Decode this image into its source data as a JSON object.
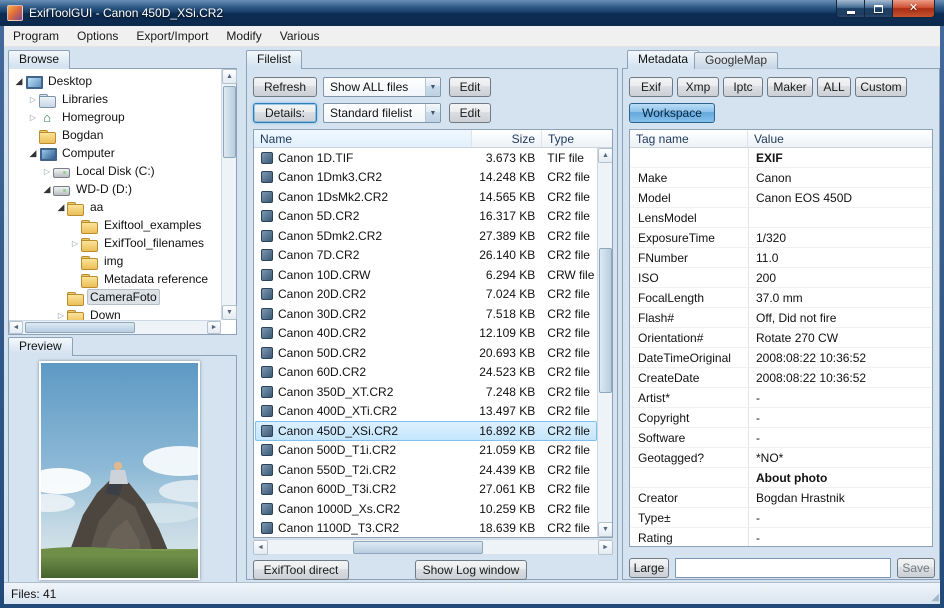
{
  "window": {
    "title": "ExifToolGUI - Canon 450D_XSi.CR2",
    "status": "Files: 41"
  },
  "menubar": {
    "items": [
      "Program",
      "Options",
      "Export/Import",
      "Modify",
      "Various"
    ]
  },
  "browse": {
    "tab_label": "Browse",
    "tree": [
      {
        "label": "Desktop",
        "level": 0,
        "icon": "desktop",
        "expander": "expanded",
        "selected": false
      },
      {
        "label": "Libraries",
        "level": 1,
        "icon": "libraries",
        "expander": "collapsed",
        "selected": false
      },
      {
        "label": "Homegroup",
        "level": 1,
        "icon": "homegroup",
        "expander": "collapsed",
        "selected": false
      },
      {
        "label": "Bogdan",
        "level": 1,
        "icon": "user",
        "expander": "none",
        "selected": false
      },
      {
        "label": "Computer",
        "level": 1,
        "icon": "computer",
        "expander": "expanded",
        "selected": false
      },
      {
        "label": "Local Disk (C:)",
        "level": 2,
        "icon": "disk",
        "expander": "collapsed",
        "selected": false
      },
      {
        "label": "WD-D (D:)",
        "level": 2,
        "icon": "disk",
        "expander": "expanded",
        "selected": false
      },
      {
        "label": "aa",
        "level": 3,
        "icon": "folder",
        "expander": "expanded",
        "selected": false
      },
      {
        "label": "Exiftool_examples",
        "level": 4,
        "icon": "folder",
        "expander": "none",
        "selected": false
      },
      {
        "label": "ExifTool_filenames",
        "level": 4,
        "icon": "folder",
        "expander": "collapsed",
        "selected": false
      },
      {
        "label": "img",
        "level": 4,
        "icon": "folder",
        "expander": "none",
        "selected": false
      },
      {
        "label": "Metadata reference",
        "level": 4,
        "icon": "folder",
        "expander": "none",
        "selected": false
      },
      {
        "label": "CameraFoto",
        "level": 3,
        "icon": "folder",
        "expander": "none",
        "selected": true
      },
      {
        "label": "Down",
        "level": 3,
        "icon": "folder",
        "expander": "collapsed",
        "selected": false
      }
    ]
  },
  "preview": {
    "tab_label": "Preview"
  },
  "filelist": {
    "tab_label": "Filelist",
    "refresh_label": "Refresh",
    "filter_value": "Show ALL files",
    "filter_edit_label": "Edit",
    "details_label": "Details:",
    "details_value": "Standard filelist",
    "details_edit_label": "Edit",
    "columns": [
      "Name",
      "Size",
      "Type"
    ],
    "rows": [
      {
        "name": "Canon 1D.TIF",
        "size": "3.673 KB",
        "type": "TIF file",
        "selected": false
      },
      {
        "name": "Canon 1Dmk3.CR2",
        "size": "14.248 KB",
        "type": "CR2 file",
        "selected": false
      },
      {
        "name": "Canon 1DsMk2.CR2",
        "size": "14.565 KB",
        "type": "CR2 file",
        "selected": false
      },
      {
        "name": "Canon 5D.CR2",
        "size": "16.317 KB",
        "type": "CR2 file",
        "selected": false
      },
      {
        "name": "Canon 5Dmk2.CR2",
        "size": "27.389 KB",
        "type": "CR2 file",
        "selected": false
      },
      {
        "name": "Canon 7D.CR2",
        "size": "26.140 KB",
        "type": "CR2 file",
        "selected": false
      },
      {
        "name": "Canon 10D.CRW",
        "size": "6.294 KB",
        "type": "CRW file",
        "selected": false
      },
      {
        "name": "Canon 20D.CR2",
        "size": "7.024 KB",
        "type": "CR2 file",
        "selected": false
      },
      {
        "name": "Canon 30D.CR2",
        "size": "7.518 KB",
        "type": "CR2 file",
        "selected": false
      },
      {
        "name": "Canon 40D.CR2",
        "size": "12.109 KB",
        "type": "CR2 file",
        "selected": false
      },
      {
        "name": "Canon 50D.CR2",
        "size": "20.693 KB",
        "type": "CR2 file",
        "selected": false
      },
      {
        "name": "Canon 60D.CR2",
        "size": "24.523 KB",
        "type": "CR2 file",
        "selected": false
      },
      {
        "name": "Canon 350D_XT.CR2",
        "size": "7.248 KB",
        "type": "CR2 file",
        "selected": false
      },
      {
        "name": "Canon 400D_XTi.CR2",
        "size": "13.497 KB",
        "type": "CR2 file",
        "selected": false
      },
      {
        "name": "Canon 450D_XSi.CR2",
        "size": "16.892 KB",
        "type": "CR2 file",
        "selected": true
      },
      {
        "name": "Canon 500D_T1i.CR2",
        "size": "21.059 KB",
        "type": "CR2 file",
        "selected": false
      },
      {
        "name": "Canon 550D_T2i.CR2",
        "size": "24.439 KB",
        "type": "CR2 file",
        "selected": false
      },
      {
        "name": "Canon 600D_T3i.CR2",
        "size": "27.061 KB",
        "type": "CR2 file",
        "selected": false
      },
      {
        "name": "Canon 1000D_Xs.CR2",
        "size": "10.259 KB",
        "type": "CR2 file",
        "selected": false
      },
      {
        "name": "Canon 1100D_T3.CR2",
        "size": "18.639 KB",
        "type": "CR2 file",
        "selected": false
      }
    ],
    "exiftool_direct_label": "ExifTool direct",
    "show_log_label": "Show Log window"
  },
  "metadata": {
    "tabs": [
      {
        "label": "Metadata",
        "active": true
      },
      {
        "label": "GoogleMap",
        "active": false
      }
    ],
    "filter_buttons": [
      "Exif",
      "Xmp",
      "Iptc",
      "Maker",
      "ALL",
      "Custom"
    ],
    "workspace_label": "Workspace",
    "columns": [
      "Tag name",
      "Value"
    ],
    "rows": [
      {
        "tag": "",
        "value": "EXIF",
        "group": true
      },
      {
        "tag": "Make",
        "value": "Canon",
        "group": false
      },
      {
        "tag": "Model",
        "value": "Canon EOS 450D",
        "group": false
      },
      {
        "tag": "LensModel",
        "value": "",
        "group": false
      },
      {
        "tag": "ExposureTime",
        "value": "1/320",
        "group": false
      },
      {
        "tag": "FNumber",
        "value": "11.0",
        "group": false
      },
      {
        "tag": "ISO",
        "value": "200",
        "group": false
      },
      {
        "tag": "FocalLength",
        "value": "37.0 mm",
        "group": false
      },
      {
        "tag": "Flash#",
        "value": "Off, Did not fire",
        "group": false
      },
      {
        "tag": "Orientation#",
        "value": "Rotate 270 CW",
        "group": false
      },
      {
        "tag": "DateTimeOriginal",
        "value": "2008:08:22 10:36:52",
        "group": false
      },
      {
        "tag": "CreateDate",
        "value": "2008:08:22 10:36:52",
        "group": false
      },
      {
        "tag": "Artist*",
        "value": "-",
        "group": false
      },
      {
        "tag": "Copyright",
        "value": "-",
        "group": false
      },
      {
        "tag": "Software",
        "value": "-",
        "group": false
      },
      {
        "tag": "Geotagged?",
        "value": "*NO*",
        "group": false
      },
      {
        "tag": "",
        "value": "About photo",
        "group": true
      },
      {
        "tag": "Creator",
        "value": "Bogdan Hrastnik",
        "group": false
      },
      {
        "tag": "Type±",
        "value": "-",
        "group": false
      },
      {
        "tag": "Rating",
        "value": "-",
        "group": false
      }
    ],
    "large_label": "Large",
    "value_input": "",
    "save_label": "Save"
  }
}
